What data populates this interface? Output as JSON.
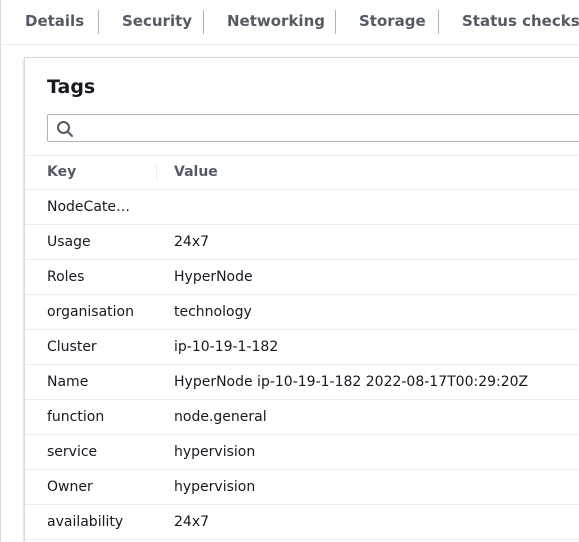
{
  "tabs": [
    {
      "label": "Details"
    },
    {
      "label": "Security"
    },
    {
      "label": "Networking"
    },
    {
      "label": "Storage"
    },
    {
      "label": "Status checks"
    }
  ],
  "tags_panel": {
    "title": "Tags",
    "search": {
      "value": "",
      "placeholder": ""
    },
    "columns": {
      "key": "Key",
      "value": "Value"
    },
    "rows": [
      {
        "key": "NodeCate…",
        "value": ""
      },
      {
        "key": "Usage",
        "value": "24x7"
      },
      {
        "key": "Roles",
        "value": "HyperNode"
      },
      {
        "key": "organisation",
        "value": "technology"
      },
      {
        "key": "Cluster",
        "value": "ip-10-19-1-182"
      },
      {
        "key": "Name",
        "value": "HyperNode ip-10-19-1-182 2022-08-17T00:29:20Z"
      },
      {
        "key": "function",
        "value": "node.general"
      },
      {
        "key": "service",
        "value": "hypervision"
      },
      {
        "key": "Owner",
        "value": "hypervision"
      },
      {
        "key": "availability",
        "value": "24x7"
      }
    ]
  },
  "icons": {
    "search": "search-icon"
  },
  "colors": {
    "text": "#16191f",
    "muted": "#545b64",
    "border": "#eaeded"
  }
}
